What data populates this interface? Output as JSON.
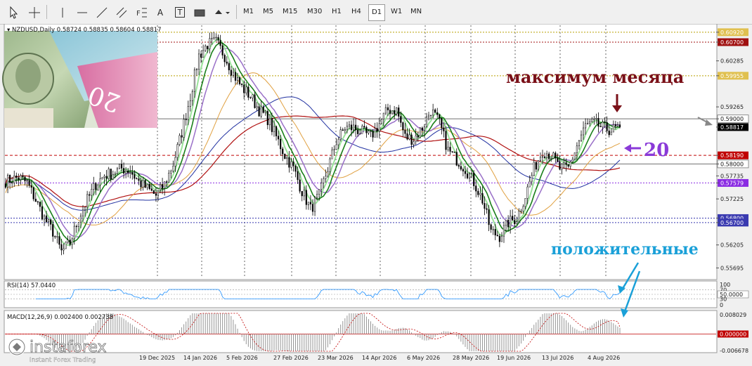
{
  "toolbar": {
    "timeframes": [
      "M1",
      "M5",
      "M15",
      "M30",
      "H1",
      "H4",
      "D1",
      "W1",
      "MN"
    ],
    "active_timeframe": "D1",
    "text_tool": "A",
    "label_tool": "T"
  },
  "chart_data": {
    "type": "candlestick",
    "symbol_header": "NZDUSD,Daily",
    "ohlc_header": "0.58724 0.58835 0.58604 0.58817",
    "current_price": "0.58817",
    "price_axis_labels": [
      "0.60920",
      "0.60700",
      "0.60285",
      "0.59955",
      "0.59265",
      "0.59000",
      "0.58817",
      "0.58190",
      "0.58000",
      "0.57735",
      "0.57579",
      "0.57225",
      "0.56800",
      "0.56700",
      "0.56205",
      "0.55695"
    ],
    "ylim": [
      0.5553,
      0.6098
    ],
    "date_labels": [
      "19 Dec 2025",
      "14 Jan 2026",
      "5 Feb 2026",
      "27 Feb 2026",
      "23 Mar 2026",
      "14 Apr 2026",
      "6 May 2026",
      "28 May 2026",
      "19 Jun 2026",
      "13 Jul 2026",
      "4 Aug 2026"
    ],
    "horizontal_levels": [
      {
        "price": "0.60920",
        "color": "#b8a000",
        "style": "dotted"
      },
      {
        "price": "0.60700",
        "color": "#a01010",
        "style": "dotted"
      },
      {
        "price": "0.59955",
        "color": "#b8a000",
        "style": "dotted"
      },
      {
        "price": "0.59000",
        "color": "#707070",
        "style": "solid"
      },
      {
        "price": "0.58190",
        "color": "#c00000",
        "style": "dashed"
      },
      {
        "price": "0.58000",
        "color": "#707070",
        "style": "solid"
      },
      {
        "price": "0.57579",
        "color": "#8a2be2",
        "style": "dotted"
      },
      {
        "price": "0.56800",
        "color": "#3a3ab0",
        "style": "dotted"
      },
      {
        "price": "0.56700",
        "color": "#3a3ab0",
        "style": "dotted"
      }
    ],
    "trend": {
      "points": [
        [
          0,
          0.5762
        ],
        [
          6,
          0.577
        ],
        [
          10,
          0.5758
        ],
        [
          14,
          0.572
        ],
        [
          18,
          0.568
        ],
        [
          22,
          0.565
        ],
        [
          26,
          0.5605
        ],
        [
          30,
          0.5625
        ],
        [
          34,
          0.568
        ],
        [
          38,
          0.572
        ],
        [
          42,
          0.5755
        ],
        [
          46,
          0.5775
        ],
        [
          50,
          0.578
        ],
        [
          54,
          0.579
        ],
        [
          58,
          0.5785
        ],
        [
          62,
          0.576
        ],
        [
          66,
          0.5745
        ],
        [
          70,
          0.573
        ],
        [
          74,
          0.5755
        ],
        [
          78,
          0.58
        ],
        [
          82,
          0.587
        ],
        [
          86,
          0.595
        ],
        [
          90,
          0.604
        ],
        [
          94,
          0.6065
        ],
        [
          98,
          0.607
        ],
        [
          102,
          0.604
        ],
        [
          106,
          0.6
        ],
        [
          110,
          0.597
        ],
        [
          114,
          0.595
        ],
        [
          118,
          0.592
        ],
        [
          122,
          0.59
        ],
        [
          126,
          0.586
        ],
        [
          130,
          0.582
        ],
        [
          134,
          0.579
        ],
        [
          138,
          0.574
        ],
        [
          142,
          0.57
        ],
        [
          146,
          0.573
        ],
        [
          150,
          0.579
        ],
        [
          154,
          0.585
        ],
        [
          158,
          0.588
        ],
        [
          162,
          0.588
        ],
        [
          166,
          0.587
        ],
        [
          170,
          0.586
        ],
        [
          174,
          0.589
        ],
        [
          178,
          0.592
        ],
        [
          182,
          0.592
        ],
        [
          186,
          0.586
        ],
        [
          190,
          0.5855
        ],
        [
          194,
          0.588
        ],
        [
          198,
          0.592
        ],
        [
          202,
          0.589
        ],
        [
          206,
          0.583
        ],
        [
          210,
          0.581
        ],
        [
          214,
          0.579
        ],
        [
          218,
          0.576
        ],
        [
          222,
          0.572
        ],
        [
          226,
          0.565
        ],
        [
          230,
          0.564
        ],
        [
          234,
          0.567
        ],
        [
          238,
          0.568
        ],
        [
          242,
          0.573
        ],
        [
          246,
          0.579
        ],
        [
          250,
          0.583
        ],
        [
          254,
          0.582
        ],
        [
          258,
          0.579
        ],
        [
          262,
          0.579
        ],
        [
          266,
          0.584
        ],
        [
          270,
          0.5885
        ],
        [
          274,
          0.589
        ],
        [
          278,
          0.588
        ],
        [
          282,
          0.5875
        ],
        [
          286,
          0.5882
        ]
      ]
    },
    "rsi": {
      "label": "RSI(14) 57.0440",
      "levels": [
        "100",
        "70",
        "50.0000",
        "30",
        "0"
      ],
      "value": 57.044
    },
    "macd": {
      "label": "MACD(12,26,9) 0.002400 0.002738",
      "levels": [
        "0.008029",
        "0.000000",
        "-0.006678"
      ],
      "main": 0.0024,
      "signal": 0.002738
    },
    "annotations": {
      "month_high": "максимум месяца",
      "ma_period": "20",
      "positive": "положительные"
    },
    "colors": {
      "bull": "#000000",
      "bear": "#000000",
      "ma_fast": "#9be39b",
      "ma_green": "#1a7f1a",
      "ma_purple": "#9a70c8",
      "ma_orange": "#e0a040",
      "ma_red": "#b01010",
      "ma_blue": "#2030a0"
    }
  },
  "branding": {
    "logo_text": "instaforex",
    "tagline": "Instant Forex Trading"
  }
}
